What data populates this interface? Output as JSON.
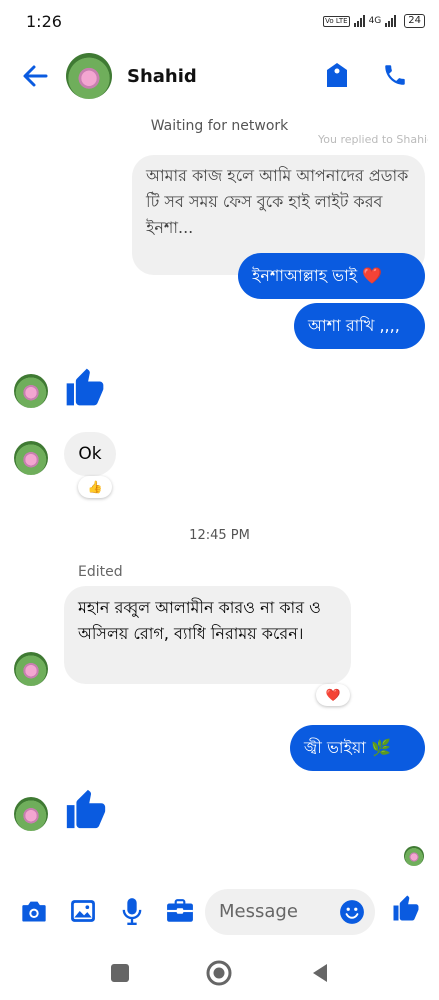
{
  "status_bar": {
    "time": "1:26",
    "network": "4G",
    "battery": "24",
    "volte": "Vo LTE"
  },
  "header": {
    "contact_name": "Shahid"
  },
  "network_banner": "Waiting for network",
  "reply_hint": "You replied to Shahid",
  "messages": [
    {
      "id": "m1",
      "side": "outgoing",
      "style": "gray",
      "text": "আমার কাজ হলে আমি আপনাদের প্রডাক টি সব সময় ফেস বুকে হাই লাইট  করব ইনশা..."
    },
    {
      "id": "m2",
      "side": "outgoing",
      "style": "blue",
      "text": "ইনশাআল্লাহ ভাই",
      "emoji": "❤️"
    },
    {
      "id": "m3",
      "side": "outgoing",
      "style": "blue",
      "text": "আশা রাখি ,,,,"
    },
    {
      "id": "m4",
      "side": "incoming",
      "type": "like-sticker"
    },
    {
      "id": "m5",
      "side": "incoming",
      "style": "gray",
      "text": "Ok",
      "reaction": "👍"
    },
    {
      "id": "m6",
      "side": "incoming",
      "style": "gray",
      "edited_label": "Edited",
      "text": "মহান রব্বুল আলামীন  কারও না কার ও অসিলয়  রোগ, ব্যাধি নিরাময় করেন।",
      "reaction": "❤️"
    },
    {
      "id": "m7",
      "side": "outgoing",
      "style": "blue",
      "text": "জ্বী ভাইয়া",
      "emoji": "🌿"
    },
    {
      "id": "m8",
      "side": "incoming",
      "type": "like-sticker"
    }
  ],
  "timestamp_separator": "12:45 PM",
  "composer": {
    "placeholder": "Message"
  },
  "colors": {
    "accent": "#0a5be0",
    "bubble_gray": "#f0f0f0"
  }
}
